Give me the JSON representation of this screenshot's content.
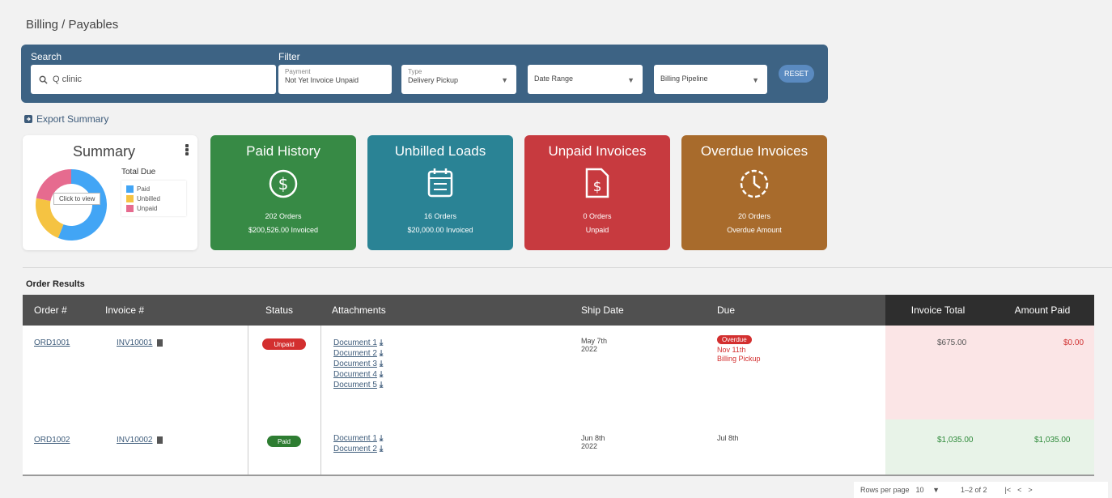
{
  "page": {
    "title": "Billing / Payables"
  },
  "filters": {
    "search_label": "Search",
    "search_value": "Q clinic",
    "filter_label": "Filter",
    "pill1_caption": "Payment",
    "pill1_value": "Not Yet Invoice Unpaid",
    "pill2_caption": "Type",
    "pill2_value": "Delivery Pickup",
    "pill3_value": "Date Range",
    "pill4_value": "Billing Pipeline",
    "reset_label": "RESET"
  },
  "export": {
    "label": "Export Summary"
  },
  "summary": {
    "title": "Summary",
    "donut_label": "Click to view",
    "legend_title": "Total Due",
    "legend": [
      {
        "label": "Paid",
        "color": "#42a5f5"
      },
      {
        "label": "Unbilled",
        "color": "#f5c342"
      },
      {
        "label": "Unpaid",
        "color": "#e66b8f"
      }
    ],
    "donut_values": [
      0.56,
      0.22,
      0.22
    ]
  },
  "tiles": [
    {
      "title": "Paid History",
      "line1": "202 Orders",
      "line2": "$200,526.00 Invoiced",
      "color": "#378a45",
      "icon": "dollar-circle-icon"
    },
    {
      "title": "Unbilled Loads",
      "line1": "16 Orders",
      "line2": "$20,000.00 Invoiced",
      "color": "#2a8395",
      "icon": "calendar-list-icon"
    },
    {
      "title": "Unpaid Invoices",
      "line1": "0 Orders",
      "line2": "Unpaid",
      "color": "#c73a3f",
      "icon": "invoice-dollar-icon"
    },
    {
      "title": "Overdue Invoices",
      "line1": "20 Orders",
      "line2": "Overdue Amount",
      "color": "#a86b2c",
      "icon": "clock-icon"
    }
  ],
  "table": {
    "section_title": "Order Results",
    "headers": [
      "Order #",
      "Invoice #",
      "Status",
      "Attachments",
      "Ship Date",
      "Due",
      "Invoice Total",
      "Amount Paid"
    ],
    "rows": [
      {
        "order": "ORD1001",
        "invoice": "INV10001",
        "status": "Unpaid",
        "status_color": "#d32f2f",
        "attachments": [
          "Document 1",
          "Document 2",
          "Document 3",
          "Document 4",
          "Document 5"
        ],
        "ship_date_1": "May 7th",
        "ship_date_2": "2022",
        "due_badge": "Overdue",
        "due_line2": "Nov 11th",
        "due_line3": "Billing Pickup",
        "invoice_total": "$675.00",
        "amount_paid": "$0.00",
        "row_color": "pink"
      },
      {
        "order": "ORD1002",
        "invoice": "INV10002",
        "status": "Paid",
        "status_color": "#2e7d32",
        "attachments": [
          "Document 1",
          "Document 2"
        ],
        "ship_date_1": "Jun 8th",
        "ship_date_2": "2022",
        "due_badge": "",
        "due_line2": "",
        "due_line3": "",
        "due_text": "Jul 8th",
        "invoice_total": "$1,035.00",
        "amount_paid": "$1,035.00",
        "row_color": "green"
      }
    ]
  },
  "pagination": {
    "rows_label": "Rows per page",
    "rows_value": "10",
    "range": "1–2 of 2"
  }
}
